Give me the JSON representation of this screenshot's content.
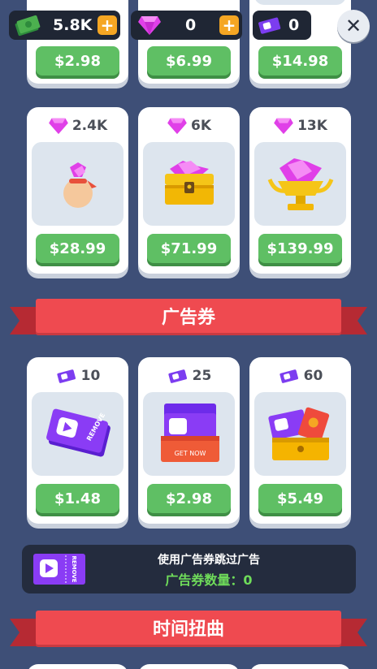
{
  "topbar": {
    "cash": "5.8K",
    "gems": "0",
    "tickets": "0",
    "plus_label": "+",
    "close_label": "✕"
  },
  "row0": {
    "prices": [
      "$2.98",
      "$6.99",
      "$14.98"
    ]
  },
  "gems_row": {
    "items": [
      {
        "amount": "2.4K",
        "price": "$28.99"
      },
      {
        "amount": "6K",
        "price": "$71.99"
      },
      {
        "amount": "13K",
        "price": "$139.99"
      }
    ]
  },
  "ticket_section": {
    "title": "广告券",
    "items": [
      {
        "amount": "10",
        "price": "$1.48"
      },
      {
        "amount": "25",
        "price": "$2.98"
      },
      {
        "amount": "60",
        "price": "$5.49"
      }
    ],
    "ticket_text": "REMOVE",
    "get_now_text": "GET NOW"
  },
  "info_panel": {
    "line1": "使用广告券跳过广告",
    "line2": "广告券数量：0",
    "line2_color": "#6fdc5a"
  },
  "time_section": {
    "title": "时间扭曲"
  },
  "colors": {
    "bg": "#3e4f77",
    "green": "#5fbf64",
    "red": "#ef4a50",
    "gem": "#e040e8"
  }
}
